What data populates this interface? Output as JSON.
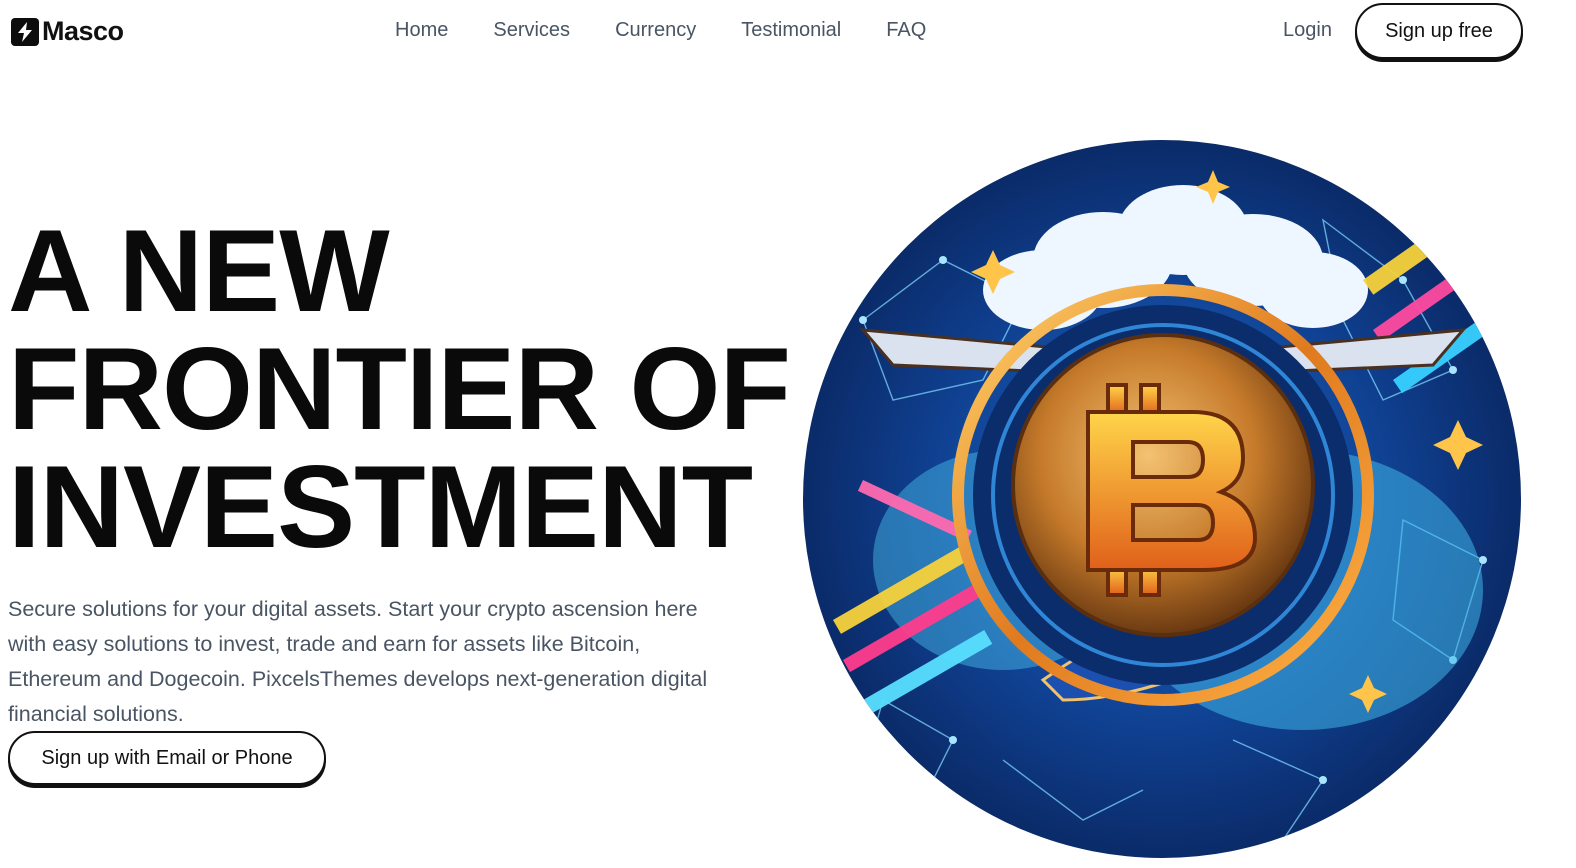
{
  "brand": {
    "name": "Masco",
    "icon": "lightning-bolt-icon"
  },
  "nav": {
    "items": [
      {
        "label": "Home"
      },
      {
        "label": "Services"
      },
      {
        "label": "Currency"
      },
      {
        "label": "Testimonial"
      },
      {
        "label": "FAQ"
      }
    ]
  },
  "header_actions": {
    "login_label": "Login",
    "signup_label": "Sign up free"
  },
  "hero": {
    "title_lines": [
      "A NEW",
      "FRONTIER OF",
      "INVESTMENT"
    ],
    "description": "Secure solutions for your digital assets. Start your crypto ascension here with easy solutions to invest, trade and earn for assets like Bitcoin, Ethereum and Dogecoin. PixcelsThemes develops next-generation digital financial solutions.",
    "cta_label": "Sign up with Email or Phone",
    "image": {
      "subject": "bitcoin-coin-illustration",
      "symbol": "B"
    }
  },
  "colors": {
    "text_primary": "#0a0a0a",
    "text_muted": "#4a5563",
    "button_border": "#111111",
    "background": "#ffffff"
  }
}
